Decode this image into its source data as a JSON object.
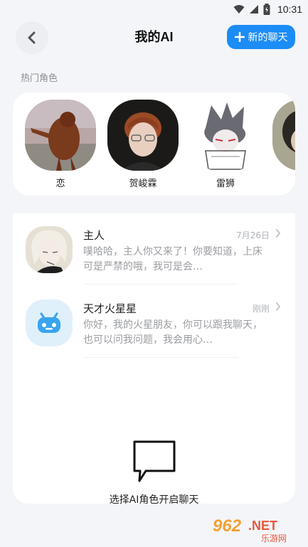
{
  "status_bar": {
    "time": "10:31"
  },
  "header": {
    "title": "我的AI",
    "new_chat_label": "新的聊天"
  },
  "popular": {
    "label": "热门角色",
    "characters": [
      {
        "name": "恋"
      },
      {
        "name": "贺峻霖"
      },
      {
        "name": "雷狮"
      },
      {
        "name": ""
      }
    ]
  },
  "chats": [
    {
      "name": "主人",
      "time": "7月26日",
      "preview": "噗哈哈，主人你又来了！你要知道，上床可是严禁的哦，我可是会…"
    },
    {
      "name": "天才火星星",
      "time": "刚刚",
      "preview": "你好，我的火星朋友，你可以跟我聊天，也可以问我问题，我会用心…"
    }
  ],
  "empty_state": {
    "text": "选择AI角色开启聊天"
  },
  "watermark": {
    "text": "962.NET",
    "subtext": "乐游网"
  },
  "colors": {
    "accent": "#1c8cf6",
    "background": "#f4f5f9"
  }
}
